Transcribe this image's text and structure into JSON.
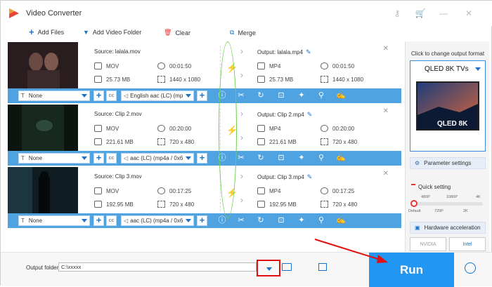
{
  "app": {
    "title": "Video Converter"
  },
  "toolbar": {
    "add_files": "Add Files",
    "add_video_folder": "Add Video Folder",
    "clear": "Clear",
    "merge": "Merge"
  },
  "files": [
    {
      "source": "Source: lalala.mov",
      "src_format": "MOV",
      "src_duration": "00:01:50",
      "src_size": "25.73 MB",
      "src_resolution": "1440 x 1080",
      "output": "Output: lalala.mp4",
      "out_format": "MP4",
      "out_duration": "00:01:50",
      "out_size": "25.73 MB",
      "out_resolution": "1440 x 1080",
      "subtitle": "None",
      "audio": "English aac (LC) (mp"
    },
    {
      "source": "Source: Clip 2.mov",
      "src_format": "MOV",
      "src_duration": "00:20:00",
      "src_size": "221.61 MB",
      "src_resolution": "720 x 480",
      "output": "Output: Clip 2.mp4",
      "out_format": "MP4",
      "out_duration": "00:20:00",
      "out_size": "221.61 MB",
      "out_resolution": "720 x 480",
      "subtitle": "None",
      "audio": "aac (LC) (mp4a / 0x6"
    },
    {
      "source": "Source: Clip 3.mov",
      "src_format": "MOV",
      "src_duration": "00:17:25",
      "src_size": "192.95 MB",
      "src_resolution": "720 x 480",
      "output": "Output: Clip 3.mp4",
      "out_format": "MP4",
      "out_duration": "00:17:25",
      "out_size": "192.95 MB",
      "out_resolution": "720 x 480",
      "subtitle": "None",
      "audio": "aac (LC) (mp4a / 0x6"
    }
  ],
  "right_panel": {
    "hint": "Click to change output format",
    "format_name": "QLED 8K TVs",
    "format_image_text": "QLED 8K",
    "parameter_settings": "Parameter settings",
    "quick_setting": "Quick setting",
    "ticks_top": [
      "480P",
      "1080P",
      "4K"
    ],
    "ticks_bottom": [
      "Default",
      "720P",
      "2K"
    ],
    "quick_setting_level": 0,
    "hardware_acceleration": "Hardware acceleration",
    "nvidia": "NVIDIA",
    "intel": "Intel"
  },
  "bottom": {
    "output_folder_label": "Output folder:",
    "output_folder_value": "C:\\xxxxx",
    "run": "Run"
  },
  "colors": {
    "accent": "#2196f3",
    "strip": "#4fa3e0",
    "bolt": "#f07a1a",
    "highlight_red": "#e01010",
    "ellipse_green": "#6ccf4c"
  }
}
